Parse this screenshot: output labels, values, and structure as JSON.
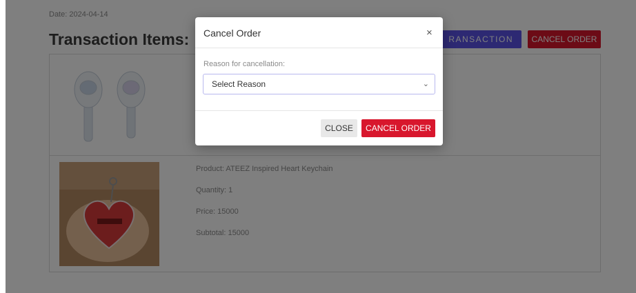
{
  "order": {
    "date": "Date: 2024-04-14",
    "heading": "Transaction Items:"
  },
  "actions": {
    "transaction_label": "RANSACTION",
    "cancel_order_label": "CANCEL ORDER"
  },
  "items": [
    {
      "product": "",
      "quantity": "",
      "price": "",
      "subtotal": ""
    },
    {
      "product": "Product: ATEEZ Inspired Heart Keychain",
      "quantity": "Quantity: 1",
      "price": "Price: 15000",
      "subtotal": "Subtotal: 15000"
    }
  ],
  "modal": {
    "title": "Cancel Order",
    "close_symbol": "×",
    "label": "Reason for cancellation:",
    "select_value": "Select Reason",
    "close_button": "CLOSE",
    "cancel_button": "CANCEL ORDER"
  },
  "colors": {
    "primary": "#5a53e6",
    "danger": "#d8172d",
    "overlay": "rgba(0,0,0,0.5)"
  }
}
